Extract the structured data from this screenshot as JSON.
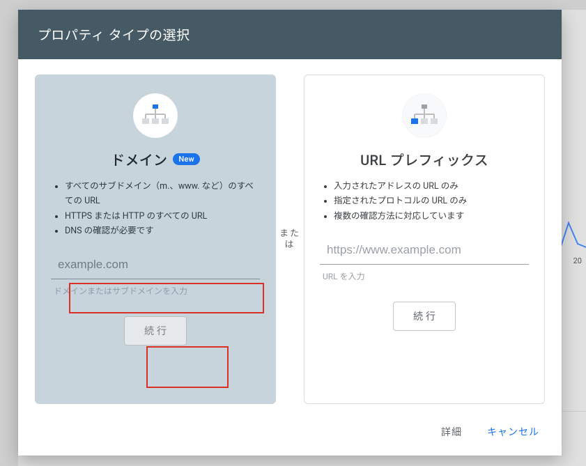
{
  "dialog": {
    "title": "プロパティ タイプの選択",
    "separator": "または",
    "footer": {
      "details": "詳細",
      "cancel": "キャンセル"
    }
  },
  "domain_card": {
    "title": "ドメイン",
    "badge": "New",
    "bullets": [
      "すべてのサブドメイン（m.、www. など）のすべての URL",
      "HTTPS または HTTP のすべての URL",
      "DNS の確認が必要です"
    ],
    "placeholder": "example.com",
    "helper": "ドメインまたはサブドメインを入力",
    "continue": "続行"
  },
  "prefix_card": {
    "title": "URL プレフィックス",
    "bullets": [
      "入力されたアドレスの URL のみ",
      "指定されたプロトコルの URL のみ",
      "複数の確認方法に対応しています"
    ],
    "placeholder": "https://www.example.com",
    "helper": "URL を入力",
    "continue": "続行"
  },
  "background": {
    "axis_tick": "20"
  },
  "colors": {
    "header_bg": "#455a64",
    "accent": "#1a73e8",
    "selected_card_bg": "#c8d4dc",
    "highlight": "#d93025"
  }
}
